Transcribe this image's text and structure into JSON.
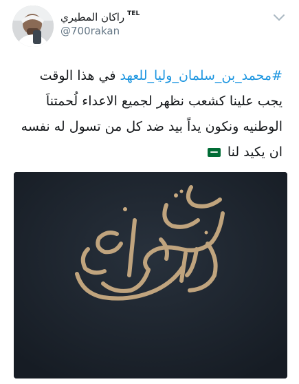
{
  "header": {
    "display_name": "راكان المطيري",
    "name_tag": "TEL",
    "handle": "@700rakan"
  },
  "tweet": {
    "hashtag": "#محمد_بن_سلمان_وليا_للعهد",
    "line1_rest": " في هذا الوقت",
    "line2": "يجب علينا كشعب نظهر لجميع الاعداء لُحمتناَ",
    "line3": "الوطنيه ونكون يداً بيد ضد كل من تسول له نفسه",
    "line4": "ان يكيد لنا"
  },
  "media": {
    "calligraphy_text": "محمد بن سلمان"
  },
  "icons": {
    "avatar": "user-avatar-photo",
    "menu": "chevron-down-icon",
    "emoji": "saudi-flag-emoji"
  },
  "colors": {
    "hashtag": "#1b95e0",
    "text": "#14171a",
    "secondary": "#657786",
    "media_background": "#1e2630",
    "calligraphy_gold": "#c9ab82"
  }
}
